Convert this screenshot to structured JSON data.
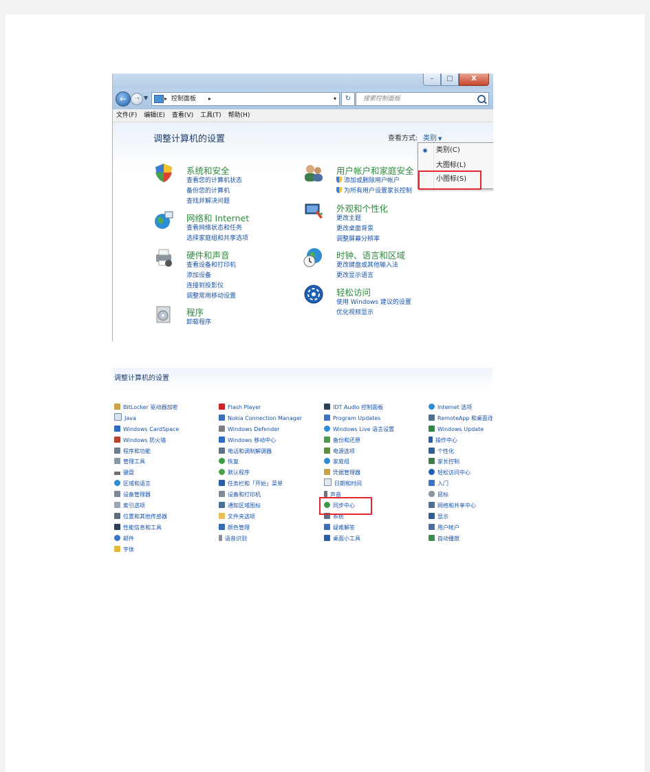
{
  "window": {
    "caption_buttons": {
      "minimize": "–",
      "maximize": "□",
      "close": "X"
    },
    "address": {
      "arrow": "▸",
      "path": "控制面板",
      "dropdown": "▾"
    },
    "refresh_glyph": "↻",
    "search_placeholder": "搜索控制面板",
    "menu": [
      "文件(F)",
      "编辑(E)",
      "查看(V)",
      "工具(T)",
      "帮助(H)"
    ]
  },
  "content": {
    "title": "调整计算机的设置",
    "view_by_label": "查看方式:",
    "view_by_value": "类别",
    "view_options": [
      "类别(C)",
      "大图标(L)",
      "小图标(S)"
    ],
    "categories": [
      {
        "title": "系统和安全",
        "links": [
          "查看您的计算机状态",
          "备份您的计算机",
          "查找并解决问题"
        ]
      },
      {
        "title": "网络和 Internet",
        "links": [
          "查看网络状态和任务",
          "选择家庭组和共享选项"
        ]
      },
      {
        "title": "硬件和声音",
        "links": [
          "查看设备和打印机",
          "添加设备",
          "连接到投影仪",
          "调整常用移动设置"
        ]
      },
      {
        "title": "程序",
        "links": [
          "卸载程序"
        ]
      },
      {
        "title": "用户帐户和家庭安全",
        "links": [
          "添加或删除用户帐户",
          "为所有用户设置家长控制"
        ]
      },
      {
        "title": "外观和个性化",
        "links": [
          "更改主题",
          "更改桌面背景",
          "调整屏幕分辨率"
        ]
      },
      {
        "title": "时钟、语言和区域",
        "links": [
          "更改键盘或其他输入法",
          "更改显示语言"
        ]
      },
      {
        "title": "轻松访问",
        "links": [
          "使用 Windows 建议的设置",
          "优化视频显示"
        ]
      }
    ]
  },
  "small_icons": {
    "title": "调整计算机的设置",
    "columns": [
      [
        "BitLocker 驱动器加密",
        "Java",
        "Windows CardSpace",
        "Windows 防火墙",
        "程序和功能",
        "管理工具",
        "键盘",
        "区域和语言",
        "设备管理器",
        "索引选项",
        "位置和其他传感器",
        "性能信息和工具",
        "邮件",
        "字体"
      ],
      [
        "Flash Player",
        "Nokia Connection Manager",
        "Windows Defender",
        "Windows 移动中心",
        "电话和调制解调器",
        "恢复",
        "默认程序",
        "任务栏和「开始」菜单",
        "设备和打印机",
        "通知区域图标",
        "文件夹选项",
        "颜色管理",
        "语音识别"
      ],
      [
        "IDT Audio 控制面板",
        "Program Updates",
        "Windows Live 语言设置",
        "备份和还原",
        "电源选项",
        "家庭组",
        "凭据管理器",
        "日期和时间",
        "声音",
        "同步中心",
        "系统",
        "疑难解答",
        "桌面小工具"
      ],
      [
        "Internet 选项",
        "RemoteApp 和桌面连接",
        "Windows Update",
        "操作中心",
        "个性化",
        "家长控制",
        "轻松访问中心",
        "入门",
        "鼠标",
        "网络和共享中心",
        "显示",
        "用户帐户",
        "自动播放"
      ]
    ]
  }
}
